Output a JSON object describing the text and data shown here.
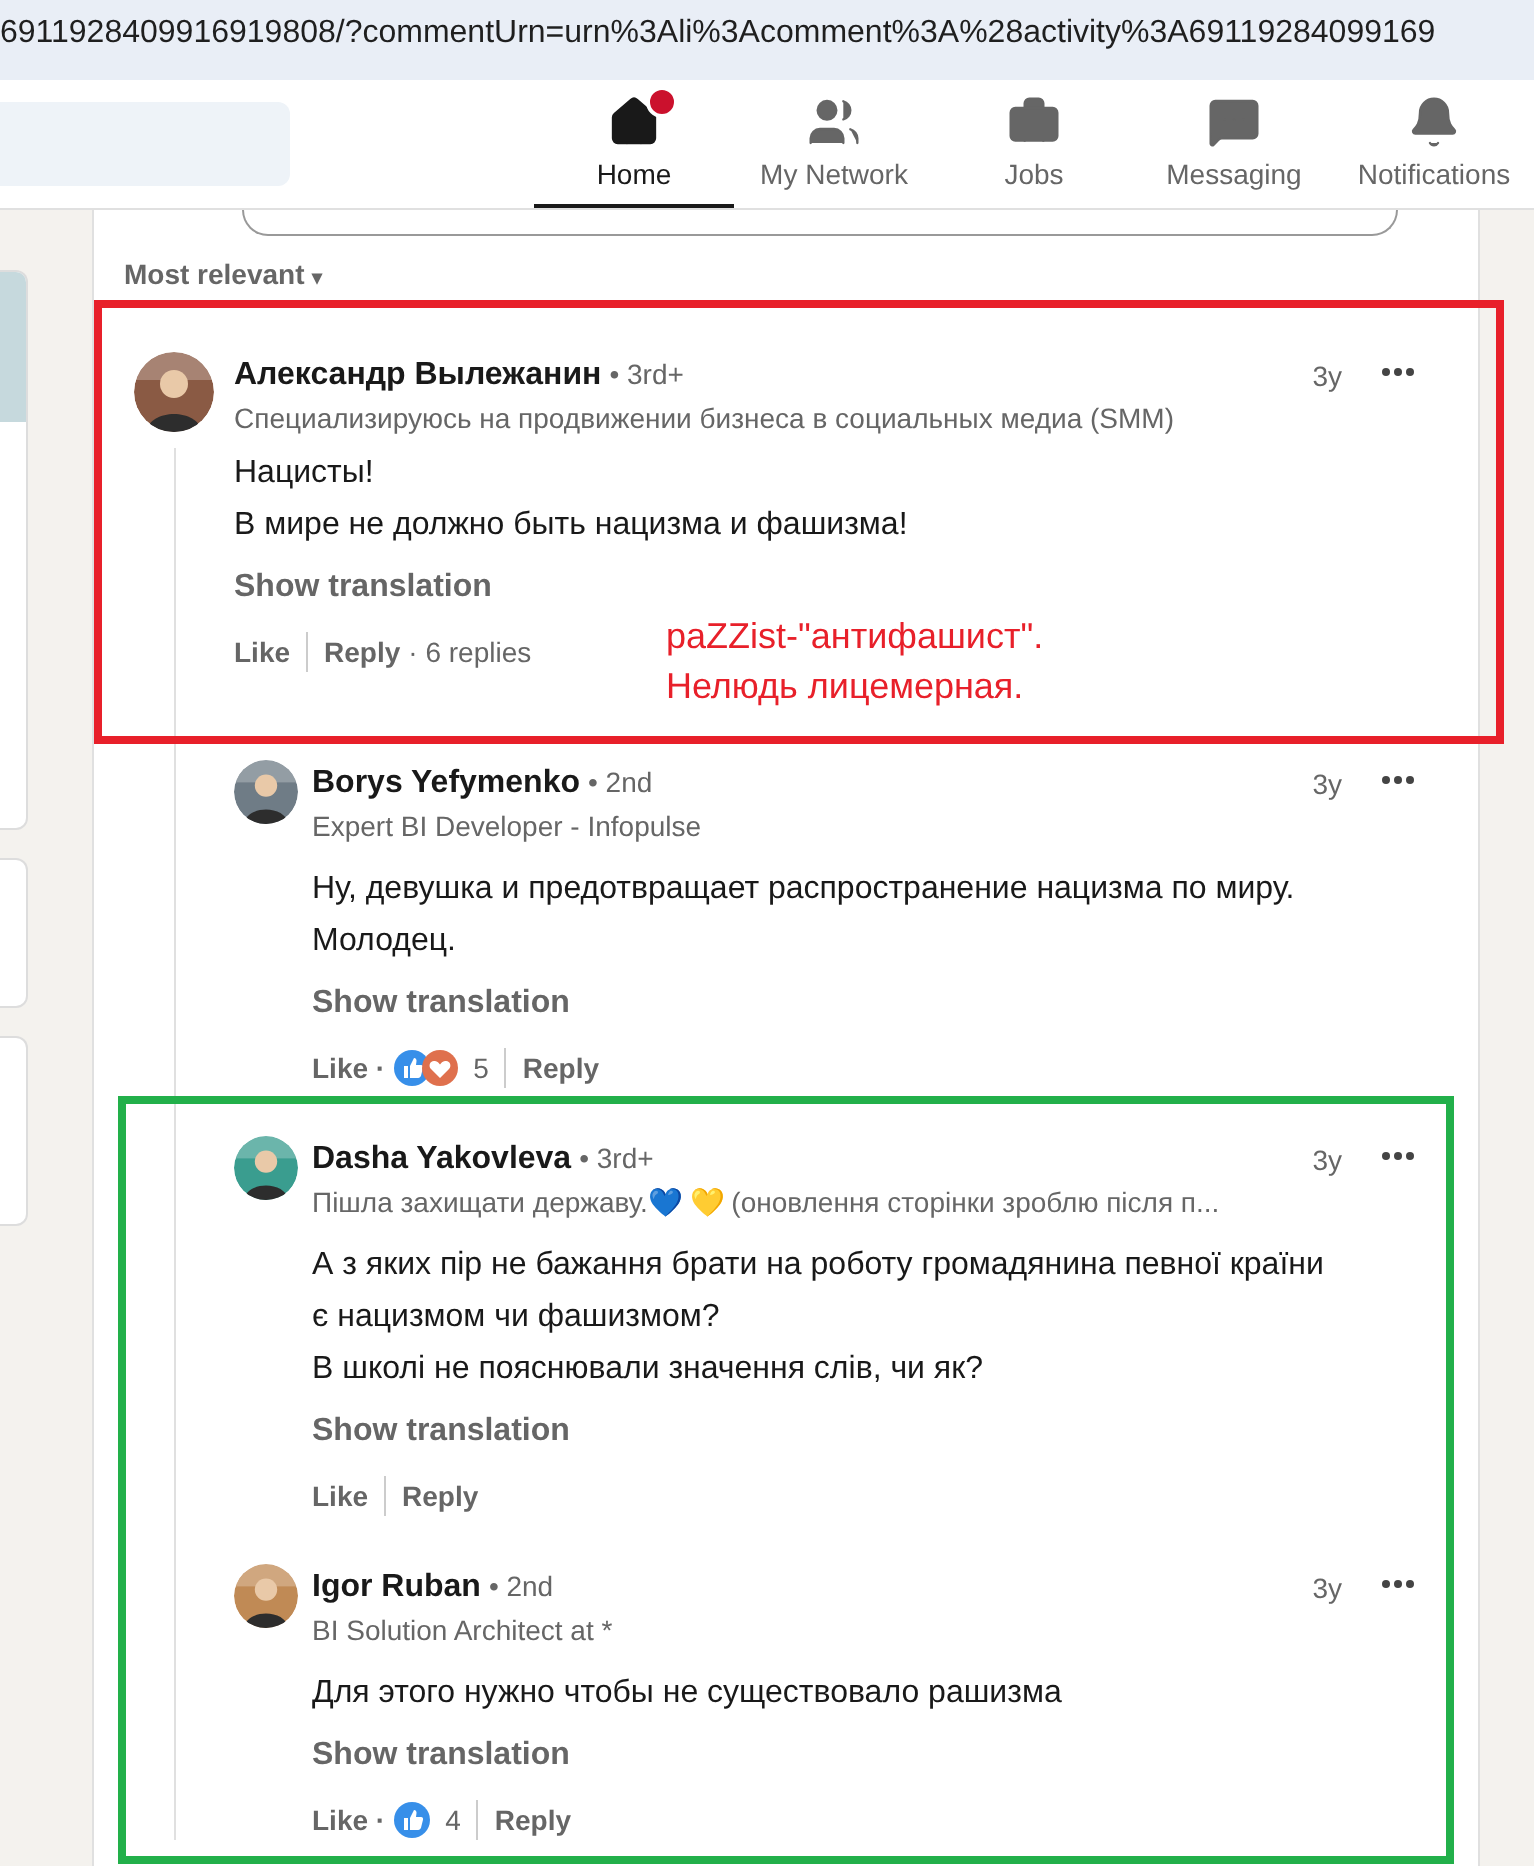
{
  "address_bar": {
    "url": "6911928409916919808/?commentUrn=urn%3Ali%3Acomment%3A%28activity%3A69119284099169"
  },
  "nav": [
    {
      "label": "Home",
      "selected": true,
      "badge": true
    },
    {
      "label": "My Network",
      "selected": false,
      "badge": false
    },
    {
      "label": "Jobs",
      "selected": false,
      "badge": false
    },
    {
      "label": "Messaging",
      "selected": false,
      "badge": false
    },
    {
      "label": "Notifications",
      "selected": false,
      "badge": false
    }
  ],
  "sort": {
    "label": "Most relevant",
    "arrow": "▾"
  },
  "comments": [
    {
      "kind": "comment",
      "name": "Александр Вылежанин",
      "degree": "• 3rd+",
      "headline": "Специализируюсь на продвижении бизнеса в социальных медиа (SMM)",
      "time": "3y",
      "body": [
        "Нацисты!",
        "В мире не должно быть нацизма и фашизма!"
      ],
      "translation": "Show translation",
      "like": "Like",
      "reply": "Reply",
      "replies": "· 6 replies",
      "children": [
        {
          "kind": "reply",
          "name": "Borys Yefymenko",
          "degree": "• 2nd",
          "headline": "Expert BI Developer - Infopulse",
          "time": "3y",
          "body": [
            "Ну, девушка и предотвращает распространение нацизма по миру.",
            "Молодец."
          ],
          "translation": "Show translation",
          "like": "Like ·",
          "reactions": {
            "kind": "like_love",
            "count": "5"
          },
          "reply": "Reply"
        },
        {
          "kind": "reply",
          "name": "Dasha Yakovleva",
          "degree": "• 3rd+",
          "headline": "Пішла захищати державу.💙 💛 (оновлення сторінки зроблю після п...",
          "time": "3y",
          "body": [
            "А з яких пір не бажання брати на роботу громадянина певної країни є нацизмом чи фашизмом?",
            "В школі не пояснювали значення слів, чи як?"
          ],
          "translation": "Show translation",
          "like": "Like",
          "reply": "Reply"
        },
        {
          "kind": "reply",
          "name": "Igor Ruban",
          "degree": "• 2nd",
          "headline": "BI Solution Architect at *",
          "time": "3y",
          "body": [
            "Для этого нужно чтобы не существовало рашизма"
          ],
          "translation": "Show translation",
          "like": "Like ·",
          "reactions": {
            "kind": "like",
            "count": "4"
          },
          "reply": "Reply"
        }
      ]
    }
  ],
  "annotations": [
    {
      "kind": "box",
      "color": "#e8202a"
    },
    {
      "kind": "box",
      "color": "#22b04a"
    },
    {
      "kind": "note",
      "color": "#e8202a",
      "lines": [
        "paZZist-\"антифашист\".",
        "Нелюдь лицемерная."
      ]
    }
  ]
}
